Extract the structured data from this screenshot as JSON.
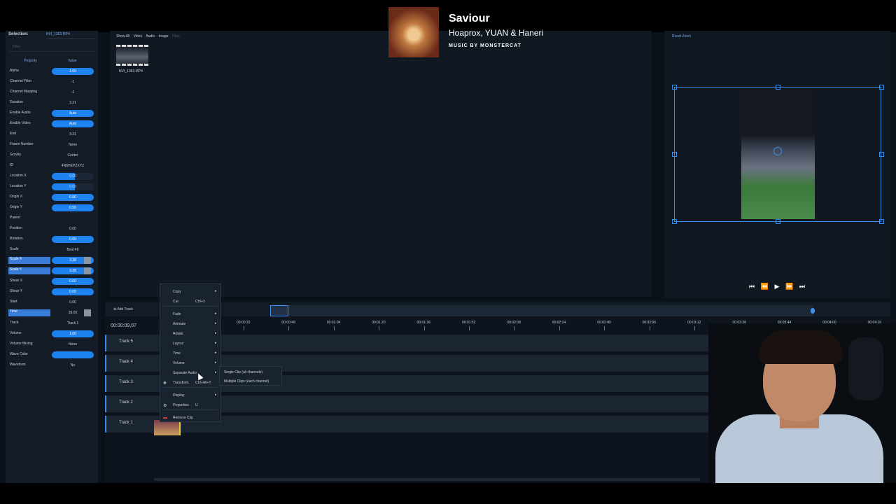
{
  "now_playing": {
    "title": "Saviour",
    "artist": "Hoaprox, YUAN & Haneri",
    "label": "MUSIC BY MONSTERCAT"
  },
  "properties": {
    "selection_label": "Selection:",
    "selection_value": "NVI_1363.MP4",
    "filter_placeholder": "Filter",
    "header_property": "Property",
    "header_value": "Value",
    "rows": [
      {
        "label": "Alpha",
        "value": "1.00",
        "style": "blue"
      },
      {
        "label": "Channel Filter",
        "value": "-1",
        "style": "plain"
      },
      {
        "label": "Channel Mapping",
        "value": "-1",
        "style": "plain"
      },
      {
        "label": "Duration",
        "value": "3.21",
        "style": "plain"
      },
      {
        "label": "Enable Audio",
        "value": "Auto",
        "style": "blue"
      },
      {
        "label": "Enable Video",
        "value": "Auto",
        "style": "blue"
      },
      {
        "label": "End",
        "value": "3.21",
        "style": "plain"
      },
      {
        "label": "Frame Number",
        "value": "None",
        "style": "plain"
      },
      {
        "label": "Gravity",
        "value": "Center",
        "style": "plain"
      },
      {
        "label": "ID",
        "value": "4N6HEPZXYZ",
        "style": "plain"
      },
      {
        "label": "Location X",
        "value": "0.00",
        "style": "half"
      },
      {
        "label": "Location Y",
        "value": "0.00",
        "style": "half"
      },
      {
        "label": "Origin X",
        "value": "0.50",
        "style": "blue"
      },
      {
        "label": "Origin Y",
        "value": "0.50",
        "style": "blue"
      },
      {
        "label": "Parent",
        "value": "",
        "style": "plain"
      },
      {
        "label": "Position",
        "value": "0.00",
        "style": "plain"
      },
      {
        "label": "Rotation",
        "value": "0.00",
        "style": "blue"
      },
      {
        "label": "Scale",
        "value": "Best Fit",
        "style": "plain"
      },
      {
        "label": "Scale X",
        "value": "3.38",
        "style": "blue",
        "highlight": true,
        "keyframe": true
      },
      {
        "label": "Scale Y",
        "value": "3.38",
        "style": "blue",
        "highlight": true,
        "keyframe": true
      },
      {
        "label": "Shear X",
        "value": "0.00",
        "style": "blue"
      },
      {
        "label": "Shear Y",
        "value": "0.00",
        "style": "blue"
      },
      {
        "label": "Start",
        "value": "0.00",
        "style": "plain"
      },
      {
        "label": "Time",
        "value": "39.00",
        "style": "plain",
        "highlight": true,
        "keyframe": true
      },
      {
        "label": "Track",
        "value": "Track 1",
        "style": "plain"
      },
      {
        "label": "Volume",
        "value": "1.00",
        "style": "blue"
      },
      {
        "label": "Volume Mixing",
        "value": "None",
        "style": "plain"
      },
      {
        "label": "Wave Color",
        "value": "",
        "style": "blue"
      },
      {
        "label": "Waveform",
        "value": "No",
        "style": "plain"
      }
    ]
  },
  "files": {
    "tabs": [
      "Show All",
      "Video",
      "Audio",
      "Image"
    ],
    "filter_placeholder": "Filter",
    "items": [
      {
        "name": "NVI_1363.MP4"
      }
    ]
  },
  "preview": {
    "reset_zoom": "Reset Zoom"
  },
  "timeline": {
    "add_track": "Add Track",
    "current_time": "00:00:09,07",
    "ticks": [
      "00:00:32",
      "00:00:48",
      "00:01:04",
      "00:01:20",
      "00:01:36",
      "00:01:52",
      "00:02:08",
      "00:02:24",
      "00:02:40",
      "00:02:56",
      "00:03:12",
      "00:03:28",
      "00:03:44",
      "00:04:00",
      "00:04:16"
    ],
    "tracks": [
      "Track 5",
      "Track 4",
      "Track 3",
      "Track 2",
      "Track 1"
    ]
  },
  "context_menu": {
    "items": [
      {
        "label": "Copy",
        "shortcut": "",
        "submenu": true
      },
      {
        "label": "Cut",
        "shortcut": "Ctrl+X",
        "submenu": false
      },
      {
        "label": "Fade",
        "shortcut": "",
        "submenu": true
      },
      {
        "label": "Animate",
        "shortcut": "",
        "submenu": true
      },
      {
        "label": "Rotate",
        "shortcut": "",
        "submenu": true
      },
      {
        "label": "Layout",
        "shortcut": "",
        "submenu": true
      },
      {
        "label": "Time",
        "shortcut": "",
        "submenu": true
      },
      {
        "label": "Volume",
        "shortcut": "",
        "submenu": true
      },
      {
        "label": "Separate Audio",
        "shortcut": "",
        "submenu": true
      },
      {
        "label": "Transform",
        "shortcut": "Ctrl+Alt+T",
        "submenu": false
      },
      {
        "label": "Display",
        "shortcut": "",
        "submenu": true
      },
      {
        "label": "Properties",
        "shortcut": "U",
        "submenu": false
      },
      {
        "label": "Remove Clip",
        "shortcut": "",
        "submenu": false
      }
    ],
    "submenu": [
      "Single Clip (all channels)",
      "Multiple Clips (each channel)"
    ]
  },
  "colors": {
    "accent": "#1e82f0",
    "background": "#0b1119",
    "panel": "#141c27"
  }
}
